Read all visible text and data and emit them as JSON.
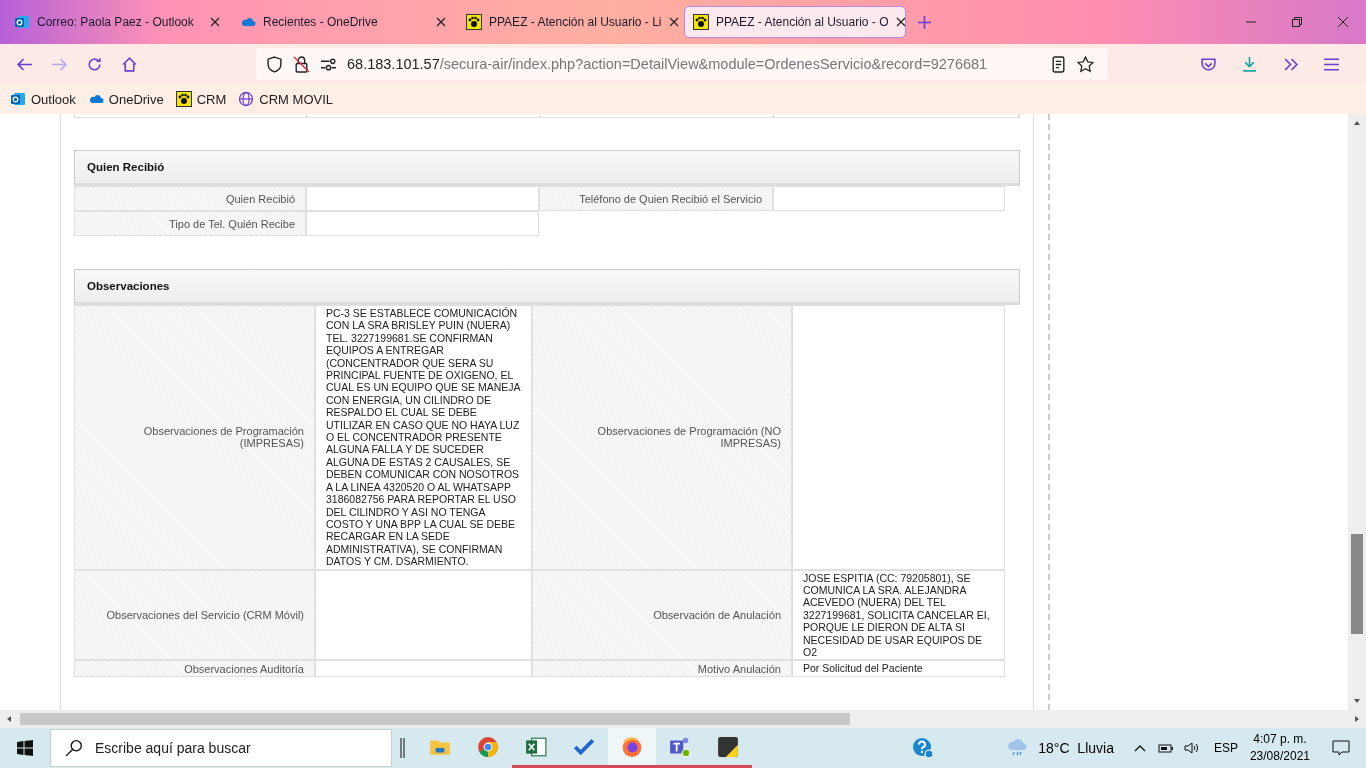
{
  "tabs": [
    {
      "kind": "outlook",
      "title": "Correo: Paola Paez - Outlook",
      "selected": false
    },
    {
      "kind": "onedrive",
      "title": "Recientes - OneDrive",
      "selected": false
    },
    {
      "kind": "crm",
      "title": "PPAEZ - Atención al Usuario - Li",
      "selected": false
    },
    {
      "kind": "crm",
      "title": "PPAEZ - Atención al Usuario - O",
      "selected": true
    }
  ],
  "address": {
    "host": "68.183.101.57",
    "path": "/secura-air/index.php?action=DetailView&module=OrdenesServicio&record=9276681"
  },
  "bookmarks": [
    {
      "kind": "outlook",
      "label": "Outlook"
    },
    {
      "kind": "onedrive",
      "label": "OneDrive"
    },
    {
      "kind": "crm",
      "label": "CRM"
    },
    {
      "kind": "globe",
      "label": "CRM MOVIL"
    }
  ],
  "sections": [
    {
      "title": "Quien Recibió",
      "kind": "grid",
      "rows": [
        [
          {
            "label": "Quien Recibió"
          },
          {
            "label": "Teléfono de Quien Recibió el Servicio"
          }
        ],
        [
          {
            "label": "Tipo de Tel. Quién Recibe"
          }
        ]
      ]
    },
    {
      "title": "Observaciones",
      "kind": "wide",
      "rows": [
        [
          {
            "label": "Observaciones de Programación (IMPRESAS)",
            "value": " PC-3 SE ESTABLECE COMUNICACIÓN CON LA SRA BRISLEY PUIN (NUERA) TEL. 3227199681.SE CONFIRMAN EQUIPOS A ENTREGAR (CONCENTRADOR QUE SERA SU PRINCIPAL FUENTE DE OXIGENO, EL CUAL ES UN EQUIPO QUE SE MANEJA CON ENERGIA, UN CILINDRO DE RESPALDO EL CUAL SE DEBE UTILIZAR EN CASO QUE NO HAYA LUZ O EL CONCENTRADOR PRESENTE ALGUNA FALLA Y DE SUCEDER ALGUNA DE ESTAS 2 CAUSALES, SE DEBEN COMUNICAR CON NOSOTROS A LA LINEA 4320520 O AL WHATSAPP 3186082756 PARA REPORTAR EL USO DEL CILINDRO Y ASI NO TENGA COSTO Y UNA BPP LA CUAL SE DEBE RECARGAR EN LA SEDE ADMINISTRATIVA), SE CONFIRMAN DATOS Y CM. DSARMIENTO."
          },
          {
            "label": "Observaciones de Programación (NO IMPRESAS)"
          }
        ],
        [
          {
            "label": "Observaciones del Servicio (CRM Móvil)"
          },
          {
            "label": "Observación de Anulación",
            "value": " JOSE ESPITIA (CC: 79205801), SE COMUNICA LA SRA. ALEJANDRA ACEVEDO (NUERA) DEL TEL 3227199681, SOLICITA CANCELAR EI, PORQUE LE DIERON DE ALTA SI NECESIDAD DE USAR EQUIPOS DE O2"
          }
        ],
        [
          {
            "label": "Observaciones Auditoría"
          },
          {
            "label": "Motivo Anulación",
            "value": "Por Solicitud del Paciente"
          }
        ]
      ]
    }
  ],
  "taskbar": {
    "search_placeholder": "Escribe aquí para buscar",
    "apps": [
      {
        "kind": "explorer",
        "open": false,
        "active": false
      },
      {
        "kind": "chrome",
        "open": false,
        "active": false
      },
      {
        "kind": "excel",
        "open": true,
        "active": false
      },
      {
        "kind": "todo",
        "open": true,
        "active": false
      },
      {
        "kind": "firefox",
        "open": true,
        "active": true
      },
      {
        "kind": "teams",
        "open": true,
        "active": false
      },
      {
        "kind": "sticky",
        "open": true,
        "active": false
      }
    ],
    "weather": "18°C  Lluvia",
    "language": "ESP",
    "time": "4:07 p. m.",
    "date": "23/08/2021"
  }
}
